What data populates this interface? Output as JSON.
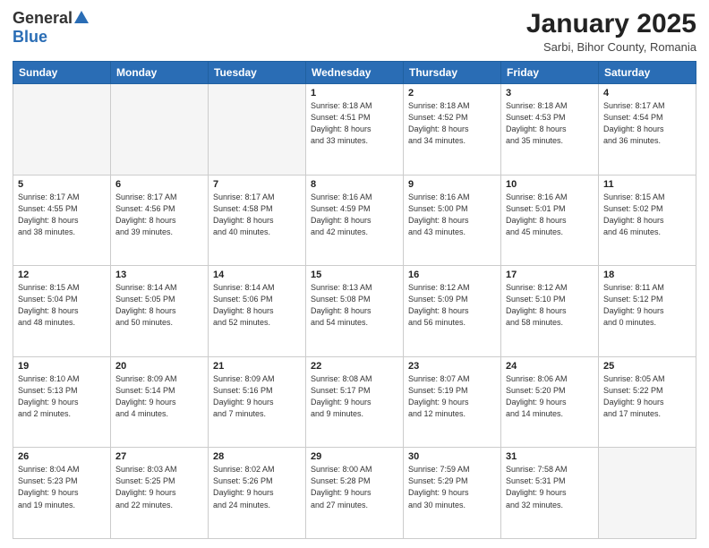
{
  "header": {
    "logo_general": "General",
    "logo_blue": "Blue",
    "month_title": "January 2025",
    "location": "Sarbi, Bihor County, Romania"
  },
  "weekdays": [
    "Sunday",
    "Monday",
    "Tuesday",
    "Wednesday",
    "Thursday",
    "Friday",
    "Saturday"
  ],
  "weeks": [
    [
      {
        "day": "",
        "info": ""
      },
      {
        "day": "",
        "info": ""
      },
      {
        "day": "",
        "info": ""
      },
      {
        "day": "1",
        "info": "Sunrise: 8:18 AM\nSunset: 4:51 PM\nDaylight: 8 hours\nand 33 minutes."
      },
      {
        "day": "2",
        "info": "Sunrise: 8:18 AM\nSunset: 4:52 PM\nDaylight: 8 hours\nand 34 minutes."
      },
      {
        "day": "3",
        "info": "Sunrise: 8:18 AM\nSunset: 4:53 PM\nDaylight: 8 hours\nand 35 minutes."
      },
      {
        "day": "4",
        "info": "Sunrise: 8:17 AM\nSunset: 4:54 PM\nDaylight: 8 hours\nand 36 minutes."
      }
    ],
    [
      {
        "day": "5",
        "info": "Sunrise: 8:17 AM\nSunset: 4:55 PM\nDaylight: 8 hours\nand 38 minutes."
      },
      {
        "day": "6",
        "info": "Sunrise: 8:17 AM\nSunset: 4:56 PM\nDaylight: 8 hours\nand 39 minutes."
      },
      {
        "day": "7",
        "info": "Sunrise: 8:17 AM\nSunset: 4:58 PM\nDaylight: 8 hours\nand 40 minutes."
      },
      {
        "day": "8",
        "info": "Sunrise: 8:16 AM\nSunset: 4:59 PM\nDaylight: 8 hours\nand 42 minutes."
      },
      {
        "day": "9",
        "info": "Sunrise: 8:16 AM\nSunset: 5:00 PM\nDaylight: 8 hours\nand 43 minutes."
      },
      {
        "day": "10",
        "info": "Sunrise: 8:16 AM\nSunset: 5:01 PM\nDaylight: 8 hours\nand 45 minutes."
      },
      {
        "day": "11",
        "info": "Sunrise: 8:15 AM\nSunset: 5:02 PM\nDaylight: 8 hours\nand 46 minutes."
      }
    ],
    [
      {
        "day": "12",
        "info": "Sunrise: 8:15 AM\nSunset: 5:04 PM\nDaylight: 8 hours\nand 48 minutes."
      },
      {
        "day": "13",
        "info": "Sunrise: 8:14 AM\nSunset: 5:05 PM\nDaylight: 8 hours\nand 50 minutes."
      },
      {
        "day": "14",
        "info": "Sunrise: 8:14 AM\nSunset: 5:06 PM\nDaylight: 8 hours\nand 52 minutes."
      },
      {
        "day": "15",
        "info": "Sunrise: 8:13 AM\nSunset: 5:08 PM\nDaylight: 8 hours\nand 54 minutes."
      },
      {
        "day": "16",
        "info": "Sunrise: 8:12 AM\nSunset: 5:09 PM\nDaylight: 8 hours\nand 56 minutes."
      },
      {
        "day": "17",
        "info": "Sunrise: 8:12 AM\nSunset: 5:10 PM\nDaylight: 8 hours\nand 58 minutes."
      },
      {
        "day": "18",
        "info": "Sunrise: 8:11 AM\nSunset: 5:12 PM\nDaylight: 9 hours\nand 0 minutes."
      }
    ],
    [
      {
        "day": "19",
        "info": "Sunrise: 8:10 AM\nSunset: 5:13 PM\nDaylight: 9 hours\nand 2 minutes."
      },
      {
        "day": "20",
        "info": "Sunrise: 8:09 AM\nSunset: 5:14 PM\nDaylight: 9 hours\nand 4 minutes."
      },
      {
        "day": "21",
        "info": "Sunrise: 8:09 AM\nSunset: 5:16 PM\nDaylight: 9 hours\nand 7 minutes."
      },
      {
        "day": "22",
        "info": "Sunrise: 8:08 AM\nSunset: 5:17 PM\nDaylight: 9 hours\nand 9 minutes."
      },
      {
        "day": "23",
        "info": "Sunrise: 8:07 AM\nSunset: 5:19 PM\nDaylight: 9 hours\nand 12 minutes."
      },
      {
        "day": "24",
        "info": "Sunrise: 8:06 AM\nSunset: 5:20 PM\nDaylight: 9 hours\nand 14 minutes."
      },
      {
        "day": "25",
        "info": "Sunrise: 8:05 AM\nSunset: 5:22 PM\nDaylight: 9 hours\nand 17 minutes."
      }
    ],
    [
      {
        "day": "26",
        "info": "Sunrise: 8:04 AM\nSunset: 5:23 PM\nDaylight: 9 hours\nand 19 minutes."
      },
      {
        "day": "27",
        "info": "Sunrise: 8:03 AM\nSunset: 5:25 PM\nDaylight: 9 hours\nand 22 minutes."
      },
      {
        "day": "28",
        "info": "Sunrise: 8:02 AM\nSunset: 5:26 PM\nDaylight: 9 hours\nand 24 minutes."
      },
      {
        "day": "29",
        "info": "Sunrise: 8:00 AM\nSunset: 5:28 PM\nDaylight: 9 hours\nand 27 minutes."
      },
      {
        "day": "30",
        "info": "Sunrise: 7:59 AM\nSunset: 5:29 PM\nDaylight: 9 hours\nand 30 minutes."
      },
      {
        "day": "31",
        "info": "Sunrise: 7:58 AM\nSunset: 5:31 PM\nDaylight: 9 hours\nand 32 minutes."
      },
      {
        "day": "",
        "info": ""
      }
    ]
  ]
}
